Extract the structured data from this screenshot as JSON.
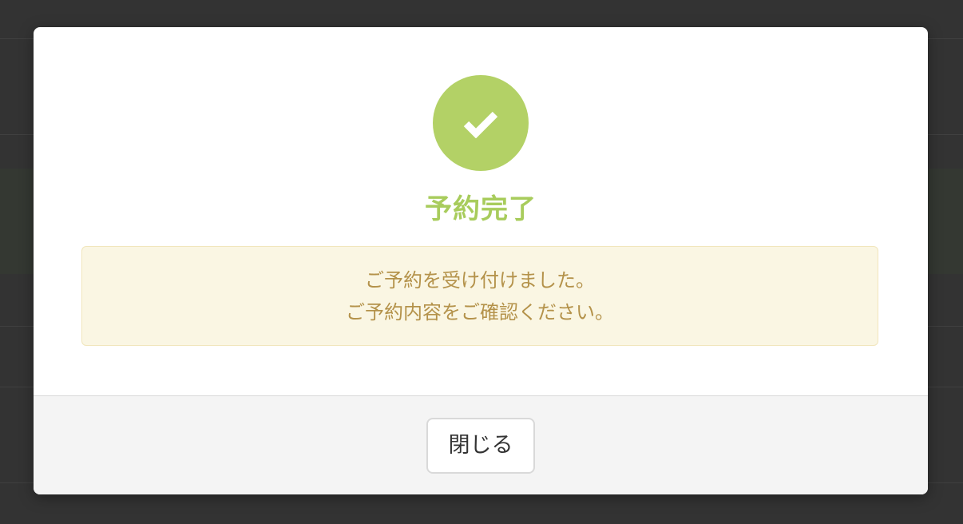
{
  "modal": {
    "icon": "check-icon",
    "title": "予約完了",
    "message_line1": "ご予約を受け付けました。",
    "message_line2": "ご予約内容をご確認ください。",
    "close_label": "閉じる"
  },
  "colors": {
    "success": "#b3d166",
    "title": "#a8cc5c",
    "alert_bg": "#faf6e3",
    "alert_text": "#b4924a",
    "backdrop": "#333333"
  }
}
